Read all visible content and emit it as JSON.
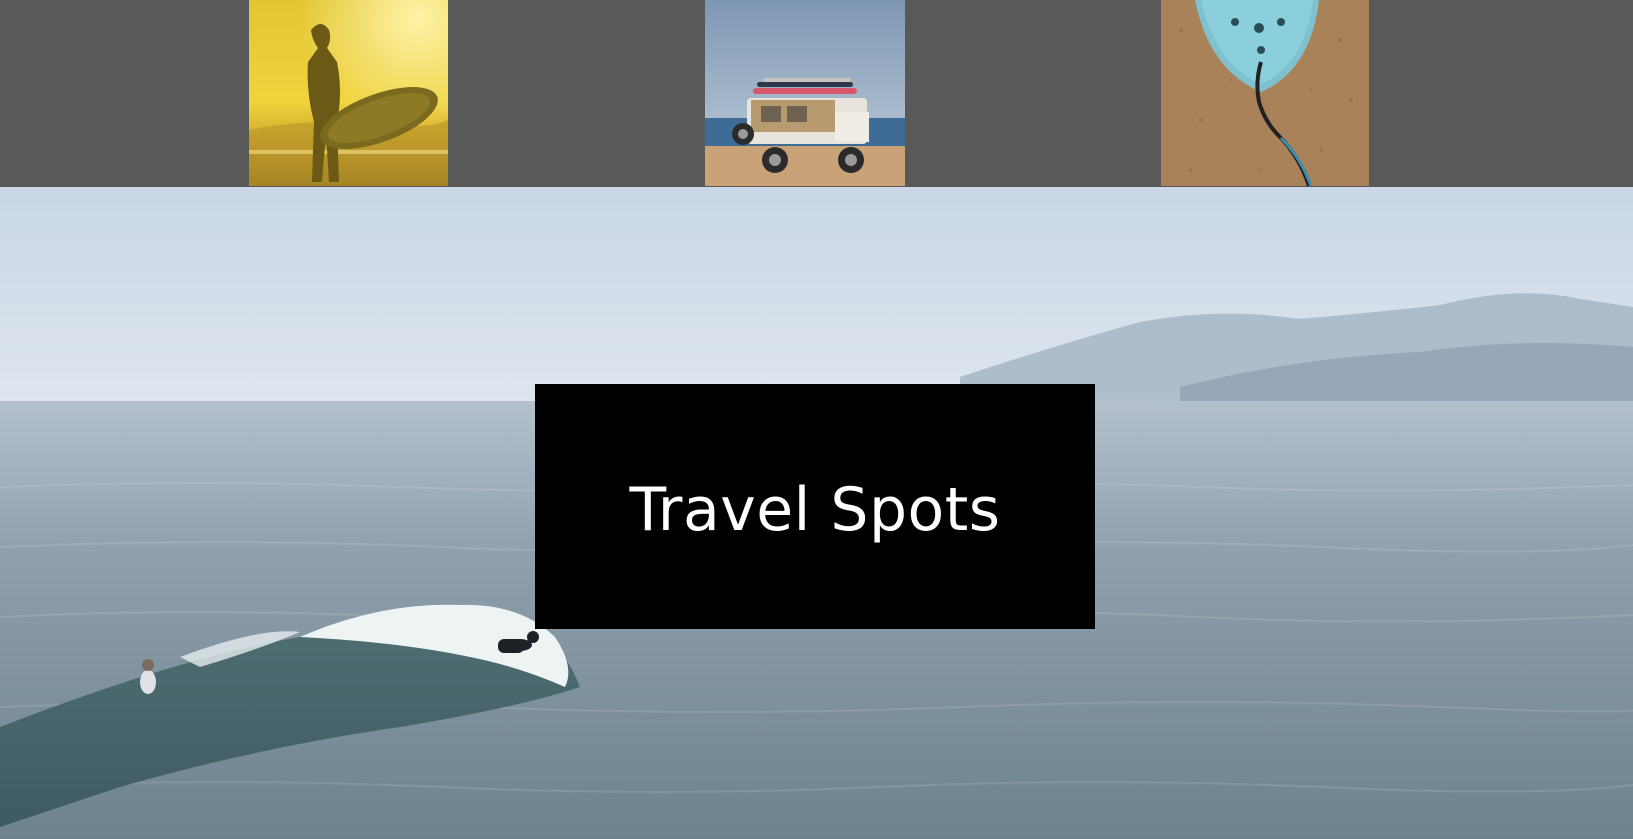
{
  "gallery": {
    "thumbnails": [
      {
        "subject": "surfer-silhouette-at-sunset"
      },
      {
        "subject": "jeep-with-surfboards-on-beach"
      },
      {
        "subject": "blue-surfboard-on-sand"
      }
    ]
  },
  "hero": {
    "subject": "surfers-riding-wave-misty-coast",
    "title": "Travel Spots"
  },
  "colors": {
    "strip_background": "#595959",
    "title_box": "#000000",
    "title_text": "#ffffff"
  }
}
